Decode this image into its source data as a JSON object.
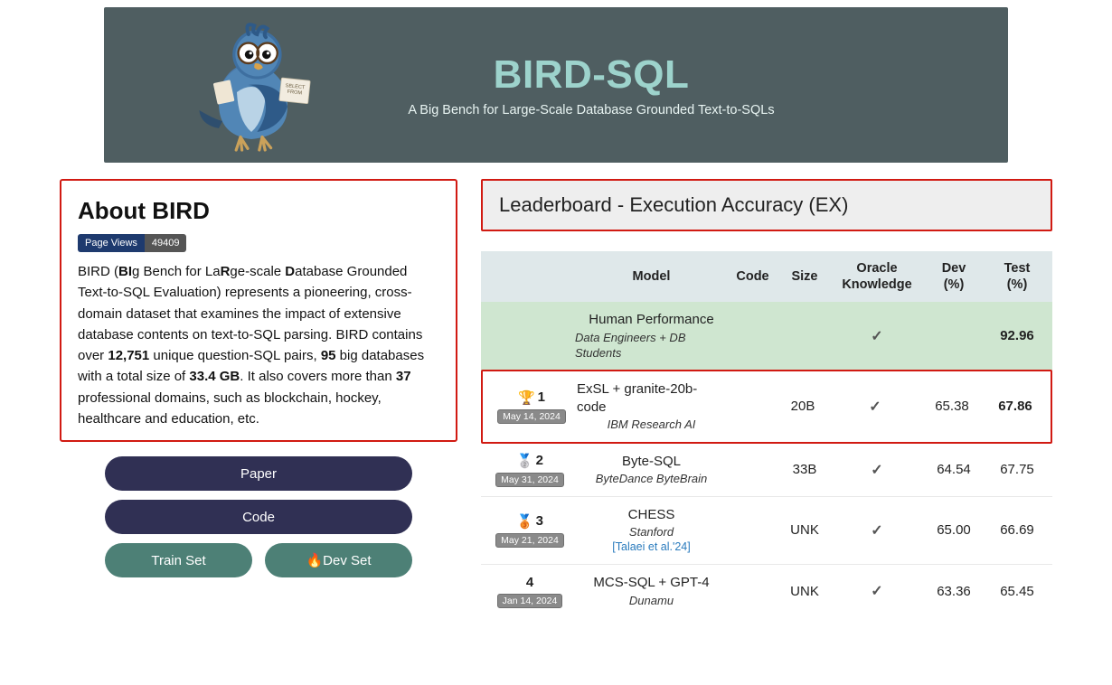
{
  "banner": {
    "title": "BIRD-SQL",
    "subtitle": "A Big Bench for Large-Scale Database Grounded Text-to-SQLs"
  },
  "about": {
    "heading": "About BIRD",
    "badge_label": "Page Views",
    "badge_value": "49409",
    "text_pre": "BIRD (",
    "bi": "BI",
    "text_g": "g Bench for La",
    "r": "R",
    "text_ge": "ge-scale ",
    "d": "D",
    "text_rest": "atabase Grounded Text-to-SQL Evaluation) represents a pioneering, cross-domain dataset that examines the impact of extensive database contents on text-to-SQL parsing. BIRD contains over ",
    "n_pairs": "12,751",
    "text_pairs": " unique question-SQL pairs, ",
    "n_dbs": "95",
    "text_dbs": " big databases with a total size of ",
    "size": "33.4 GB",
    "text_more": ". It also covers more than ",
    "n_domains": "37",
    "text_tail": " professional domains, such as blockchain, hockey, healthcare and education, etc."
  },
  "buttons": {
    "paper": "Paper",
    "code": "Code",
    "train": "Train Set",
    "dev_prefix": "🔥 ",
    "dev": "Dev Set"
  },
  "leaderboard": {
    "title": "Leaderboard - Execution Accuracy (EX)",
    "headers": {
      "model": "Model",
      "code": "Code",
      "size": "Size",
      "oracle1": "Oracle",
      "oracle2": "Knowledge",
      "dev1": "Dev",
      "dev2": "(%)",
      "test1": "Test",
      "test2": "(%)"
    },
    "human": {
      "name": "Human Performance",
      "sub": "Data Engineers + DB Students",
      "test": "92.96"
    },
    "rows": [
      {
        "rank_icon": "🏆",
        "rank": "1",
        "date": "May 14, 2024",
        "name": "ExSL + granite-20b-code",
        "sub": "IBM Research AI",
        "cite": "",
        "code": "",
        "size": "20B",
        "oracle": "✓",
        "dev": "65.38",
        "test": "67.86",
        "top": true
      },
      {
        "rank_icon": "🥈",
        "rank": "2",
        "date": "May 31, 2024",
        "name": "Byte-SQL",
        "sub": "ByteDance ByteBrain",
        "cite": "",
        "code": "",
        "size": "33B",
        "oracle": "✓",
        "dev": "64.54",
        "test": "67.75",
        "top": false
      },
      {
        "rank_icon": "🥉",
        "rank": "3",
        "date": "May 21, 2024",
        "name": "CHESS",
        "sub": "Stanford",
        "cite": "[Talaei et al.'24]",
        "code": "",
        "size": "UNK",
        "oracle": "✓",
        "dev": "65.00",
        "test": "66.69",
        "top": false
      },
      {
        "rank_icon": "",
        "rank": "4",
        "date": "Jan 14, 2024",
        "name": "MCS-SQL + GPT-4",
        "sub": "Dunamu",
        "cite": "",
        "code": "",
        "size": "UNK",
        "oracle": "✓",
        "dev": "63.36",
        "test": "65.45",
        "top": false
      }
    ]
  }
}
